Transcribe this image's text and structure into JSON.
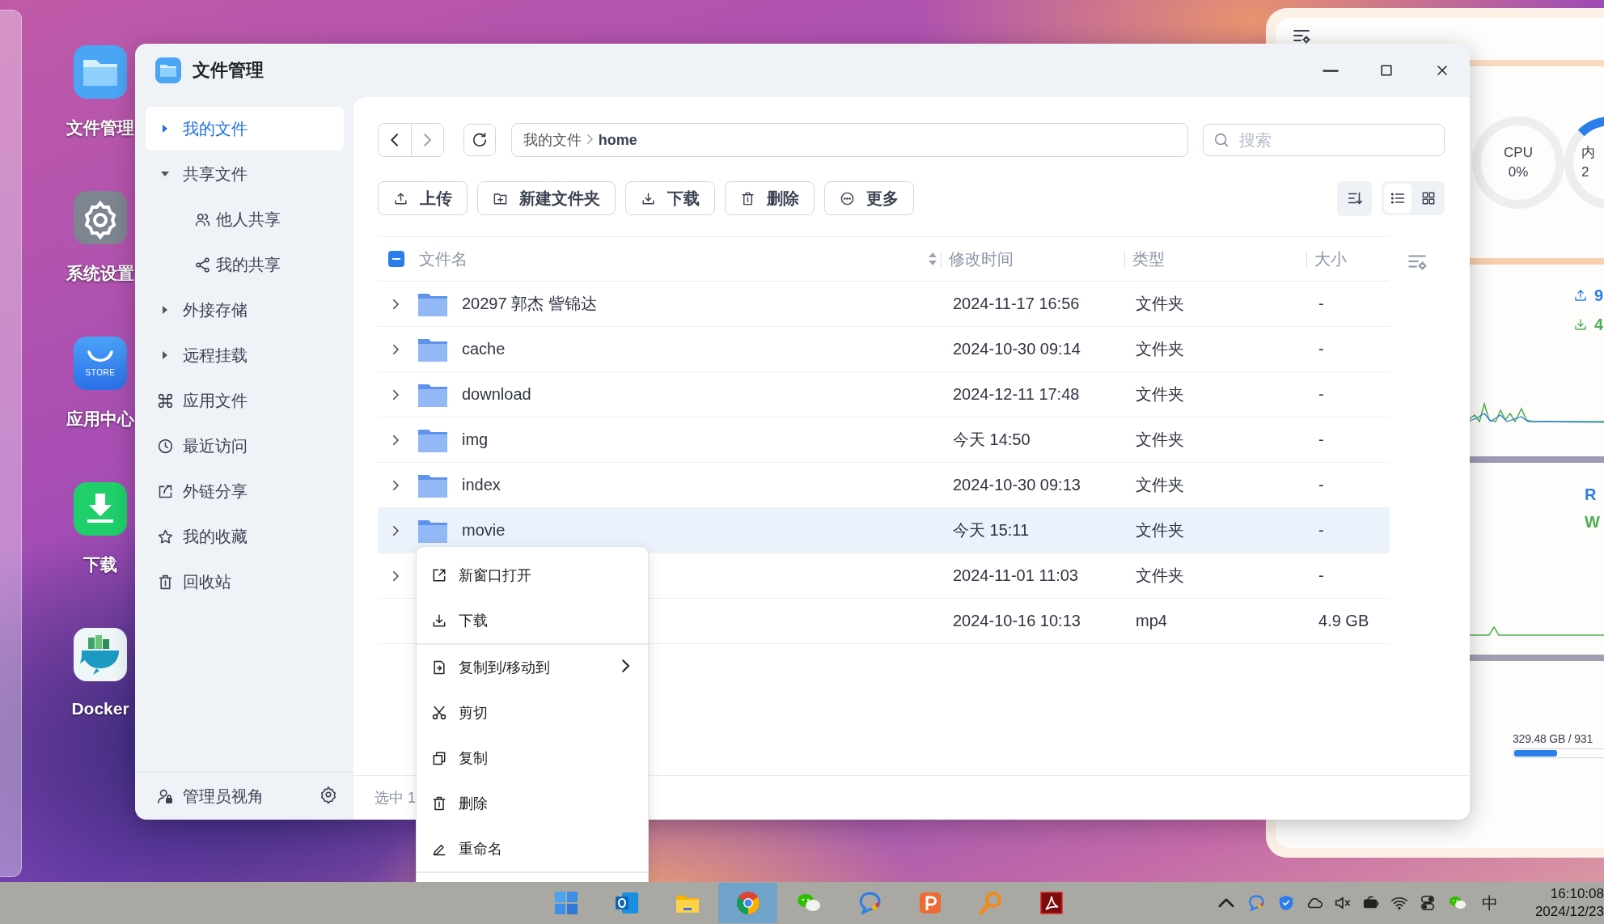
{
  "desktop": {
    "icons": [
      {
        "kind": "files",
        "label": "文件管理"
      },
      {
        "kind": "settings",
        "label": "系统设置"
      },
      {
        "kind": "store",
        "label": "应用中心",
        "icon_text": "STORE"
      },
      {
        "kind": "download",
        "label": "下载"
      },
      {
        "kind": "docker",
        "label": "Docker"
      }
    ]
  },
  "file_manager": {
    "title": "文件管理",
    "sidebar": {
      "items": [
        {
          "label": "我的文件",
          "selected": true,
          "expanded": false
        },
        {
          "label": "共享文件",
          "selected": false,
          "expanded": true,
          "children": [
            {
              "kind": "people",
              "label": "他人共享",
              "selected": false
            },
            {
              "kind": "share",
              "label": "我的共享",
              "selected": false
            }
          ]
        },
        {
          "label": "外接存储",
          "selected": false,
          "expanded": false
        },
        {
          "label": "远程挂载",
          "selected": false,
          "expanded": false
        },
        {
          "kind": "apps",
          "label": "应用文件",
          "selected": false
        },
        {
          "kind": "recent",
          "label": "最近访问",
          "selected": false
        },
        {
          "kind": "link",
          "label": "外链分享",
          "selected": false
        },
        {
          "kind": "star",
          "label": "我的收藏",
          "selected": false
        },
        {
          "kind": "trash",
          "label": "回收站",
          "selected": false
        }
      ],
      "footer": {
        "label": "管理员视角"
      }
    },
    "nav": {
      "breadcrumb": [
        "我的文件",
        "home"
      ],
      "search": {
        "placeholder": "搜索"
      }
    },
    "actions": [
      {
        "kind": "upload",
        "label": "上传"
      },
      {
        "kind": "new-folder",
        "label": "新建文件夹"
      },
      {
        "kind": "download",
        "label": "下载"
      },
      {
        "kind": "delete",
        "label": "删除"
      },
      {
        "kind": "more",
        "label": "更多"
      }
    ],
    "view_modes": [
      {
        "kind": "list",
        "selected": true
      },
      {
        "kind": "grid",
        "selected": false
      }
    ],
    "table": {
      "select_all_indeterminate": true,
      "columns": [
        "文件名",
        "修改时间",
        "类型",
        "大小"
      ],
      "rows": [
        {
          "kind": "folder",
          "name": "20297 郭杰 訾锦达",
          "modified": "2024-11-17 16:56",
          "type": "文件夹",
          "size": "-",
          "selected": false
        },
        {
          "kind": "folder",
          "name": "cache",
          "modified": "2024-10-30 09:14",
          "type": "文件夹",
          "size": "-",
          "selected": false
        },
        {
          "kind": "folder",
          "name": "download",
          "modified": "2024-12-11 17:48",
          "type": "文件夹",
          "size": "-",
          "selected": false
        },
        {
          "kind": "folder",
          "name": "img",
          "modified": "今天 14:50",
          "type": "文件夹",
          "size": "-",
          "selected": false
        },
        {
          "kind": "folder",
          "name": "index",
          "modified": "2024-10-30 09:13",
          "type": "文件夹",
          "size": "-",
          "selected": false
        },
        {
          "kind": "folder",
          "name": "movie",
          "modified": "今天 15:11",
          "type": "文件夹",
          "size": "-",
          "selected": true
        },
        {
          "kind": "folder",
          "modified": "2024-11-01 11:03",
          "type": "文件夹",
          "size": "-",
          "selected": false
        },
        {
          "kind": "file",
          "modified": "2024-10-16 10:13",
          "type": "mp4",
          "size": "4.9 GB",
          "selected": false
        }
      ]
    },
    "status_bar": "选中 1"
  },
  "context_menu": {
    "groups": [
      [
        {
          "kind": "open-new",
          "label": "新窗口打开"
        },
        {
          "kind": "download",
          "label": "下载"
        }
      ],
      [
        {
          "kind": "copy-move",
          "label": "复制到/移动到",
          "submenu": true
        },
        {
          "kind": "cut",
          "label": "剪切"
        },
        {
          "kind": "copy",
          "label": "复制"
        },
        {
          "kind": "delete",
          "label": "删除"
        },
        {
          "kind": "rename",
          "label": "重命名"
        }
      ]
    ]
  },
  "monitor": {
    "cpu": {
      "label": "CPU",
      "value": "0%"
    },
    "memory": {
      "label": "内",
      "value": "2"
    },
    "network": {
      "upload": "9",
      "download": "4"
    },
    "disk_io": {
      "read": "R",
      "write": "W"
    },
    "storage": {
      "text": "329.48 GB / 931",
      "level": 0.18
    }
  },
  "taskbar": {
    "apps": [
      {
        "kind": "windows",
        "selected": false
      },
      {
        "kind": "outlook",
        "selected": false
      },
      {
        "kind": "explorer",
        "selected": false
      },
      {
        "kind": "chrome",
        "selected": true
      },
      {
        "kind": "wechat",
        "selected": false
      },
      {
        "kind": "chat",
        "selected": false
      },
      {
        "kind": "slides",
        "selected": false
      },
      {
        "kind": "search-tool",
        "selected": false
      },
      {
        "kind": "pdf",
        "selected": false
      }
    ],
    "tray": [
      {
        "kind": "caret"
      },
      {
        "kind": "chat"
      },
      {
        "kind": "shield"
      },
      {
        "kind": "cloud"
      },
      {
        "kind": "mute"
      },
      {
        "kind": "battery"
      },
      {
        "kind": "wifi"
      },
      {
        "kind": "toggle"
      },
      {
        "kind": "wechat"
      }
    ],
    "ime": "中",
    "time": "16:10:08",
    "date": "2024/12/23"
  }
}
